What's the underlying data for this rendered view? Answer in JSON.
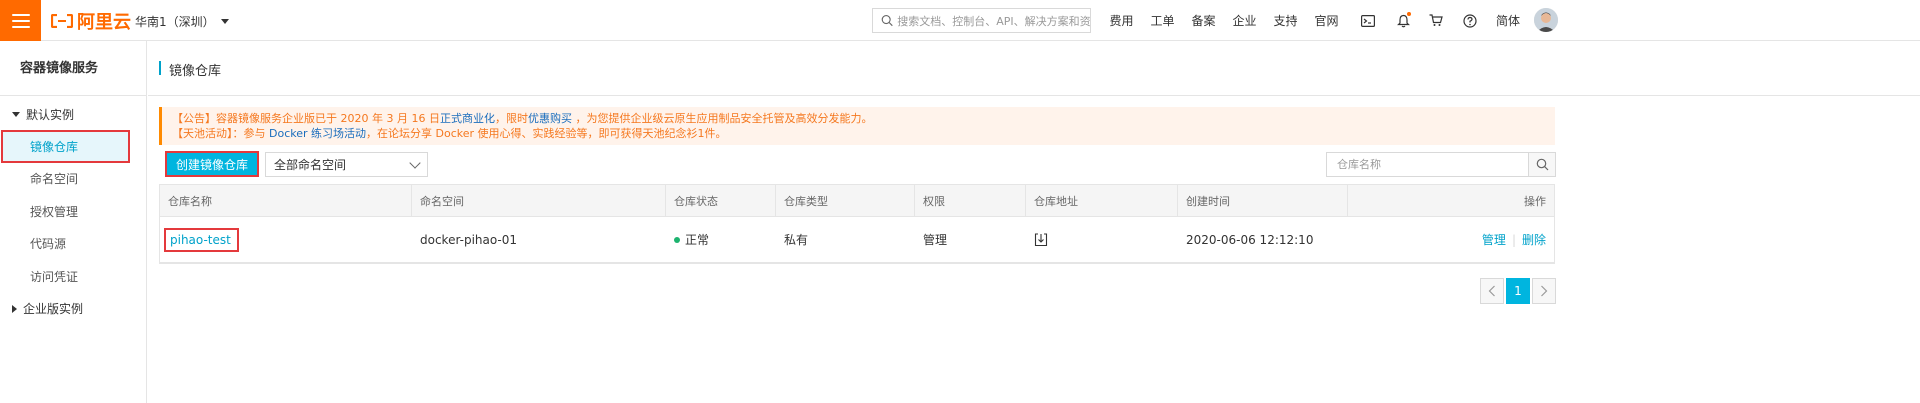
{
  "topbar": {
    "logo_text": "阿里云",
    "region": "华南1（深圳）",
    "search_placeholder": "搜索文档、控制台、API、解决方案和资源",
    "nav": [
      "费用",
      "工单",
      "备案",
      "企业",
      "支持",
      "官网"
    ],
    "lang": "简体",
    "brand_color": "#ff6a00"
  },
  "sidebar": {
    "title": "容器镜像服务",
    "group_default": "默认实例",
    "items": [
      {
        "label": "镜像仓库",
        "active": true
      },
      {
        "label": "命名空间"
      },
      {
        "label": "授权管理"
      },
      {
        "label": "代码源"
      },
      {
        "label": "访问凭证"
      }
    ],
    "group_enterprise": "企业版实例"
  },
  "main": {
    "title": "镜像仓库",
    "notice": {
      "line1_prefix": "【公告】容器镜像服务企业版已于 2020 年 3 月 16 日",
      "line1_link1": "正式商业化",
      "line1_mid": "，限时",
      "line1_link2": "优惠购买",
      "line1_suffix": " ，为您提供企业级云原生应用制品安全托管及高效分发能力。",
      "line2_prefix": "【天池活动】：参与 ",
      "line2_link": "Docker 练习场活动",
      "line2_suffix": "，在论坛分享 Docker 使用心得、实践经验等，即可获得天池纪念衫1件。"
    },
    "create_button": "创建镜像仓库",
    "namespace_select": "全部命名空间",
    "repo_search_placeholder": "仓库名称",
    "table": {
      "headers": [
        "仓库名称",
        "命名空间",
        "仓库状态",
        "仓库类型",
        "权限",
        "仓库地址",
        "创建时间",
        "操作"
      ],
      "rows": [
        {
          "name": "pihao-test",
          "namespace": "docker-pihao-01",
          "status": "正常",
          "type": "私有",
          "permission": "管理",
          "created": "2020-06-06 12:12:10",
          "action_manage": "管理",
          "action_delete": "删除"
        }
      ]
    },
    "pagination": {
      "current": "1"
    }
  },
  "colors": {
    "accent": "#00b5df",
    "link": "#00a2ca",
    "status_ok": "#1db36f",
    "highlight": "#e4393c"
  }
}
